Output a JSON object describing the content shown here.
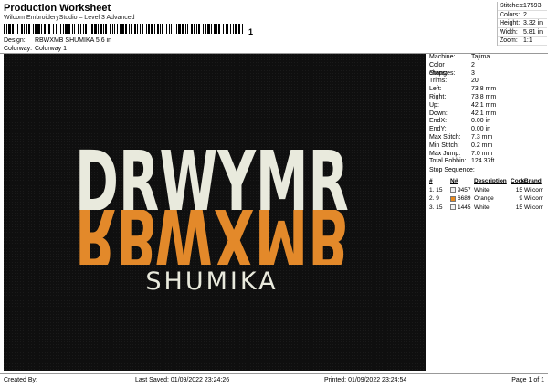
{
  "header": {
    "title": "Production Worksheet",
    "subtitle": "Wilcom EmbroideryStudio – Level 3 Advanced",
    "barcode_mark": "1"
  },
  "design": {
    "label": "Design:",
    "value": "RBWXMB SHUMIKA 5,6 in"
  },
  "colorway": {
    "label": "Colorway:",
    "value": "Colorway 1"
  },
  "summary": [
    {
      "label": "Stitches:",
      "value": "17593"
    },
    {
      "label": "Colors:",
      "value": "2"
    },
    {
      "label": "Height:",
      "value": "3.32 in"
    },
    {
      "label": "Width:",
      "value": "5.81 in"
    },
    {
      "label": "Zoom:",
      "value": "1:1"
    }
  ],
  "details": [
    {
      "label": "Machine:",
      "value": "Tajima"
    },
    {
      "label": "Color changes:",
      "value": "2"
    },
    {
      "label": "Stops:",
      "value": "3"
    },
    {
      "label": "Trims:",
      "value": "20"
    },
    {
      "label": "Left:",
      "value": "73.8 mm"
    },
    {
      "label": "Right:",
      "value": "73.8 mm"
    },
    {
      "label": "Up:",
      "value": "42.1 mm"
    },
    {
      "label": "Down:",
      "value": "42.1 mm"
    },
    {
      "label": "EndX:",
      "value": "0.00 in"
    },
    {
      "label": "EndY:",
      "value": "0.00 in"
    },
    {
      "label": "Max Stitch:",
      "value": "7.3 mm"
    },
    {
      "label": "Min Stitch:",
      "value": "0.2 mm"
    },
    {
      "label": "Max Jump:",
      "value": "7.0 mm"
    },
    {
      "label": "Total Bobbin:",
      "value": "124.37ft"
    }
  ],
  "stop_sequence": {
    "title": "Stop Sequence:",
    "headers": {
      "num": "#",
      "n": "N#",
      "description": "Description",
      "code": "Code",
      "brand": "Brand"
    },
    "rows": [
      {
        "num": "1.",
        "n": "15",
        "swatch_color": "#f2f2f2",
        "code_n": "9457",
        "description": "White",
        "code": "15",
        "brand": "Wilcom"
      },
      {
        "num": "2.",
        "n": "9",
        "swatch_color": "#e8891c",
        "code_n": "6689",
        "description": "Orange",
        "code": "9",
        "brand": "Wilcom"
      },
      {
        "num": "3.",
        "n": "15",
        "swatch_color": "#f2f2f2",
        "code_n": "1445",
        "description": "White",
        "code": "15",
        "brand": "Wilcom"
      }
    ]
  },
  "design_preview": {
    "top_text": "DRWYMR",
    "mirror_text": "RBWXMB",
    "bottom_text": "SHUMIKA",
    "colors": {
      "white": "#e9eadd",
      "orange": "#e3892a",
      "background": "#0f0f0f"
    }
  },
  "footer": {
    "created_by": "Created By:",
    "last_saved": "Last Saved: 01/09/2022 23:24:26",
    "printed": "Printed: 01/09/2022 23:24:54",
    "page": "Page 1 of 1"
  }
}
